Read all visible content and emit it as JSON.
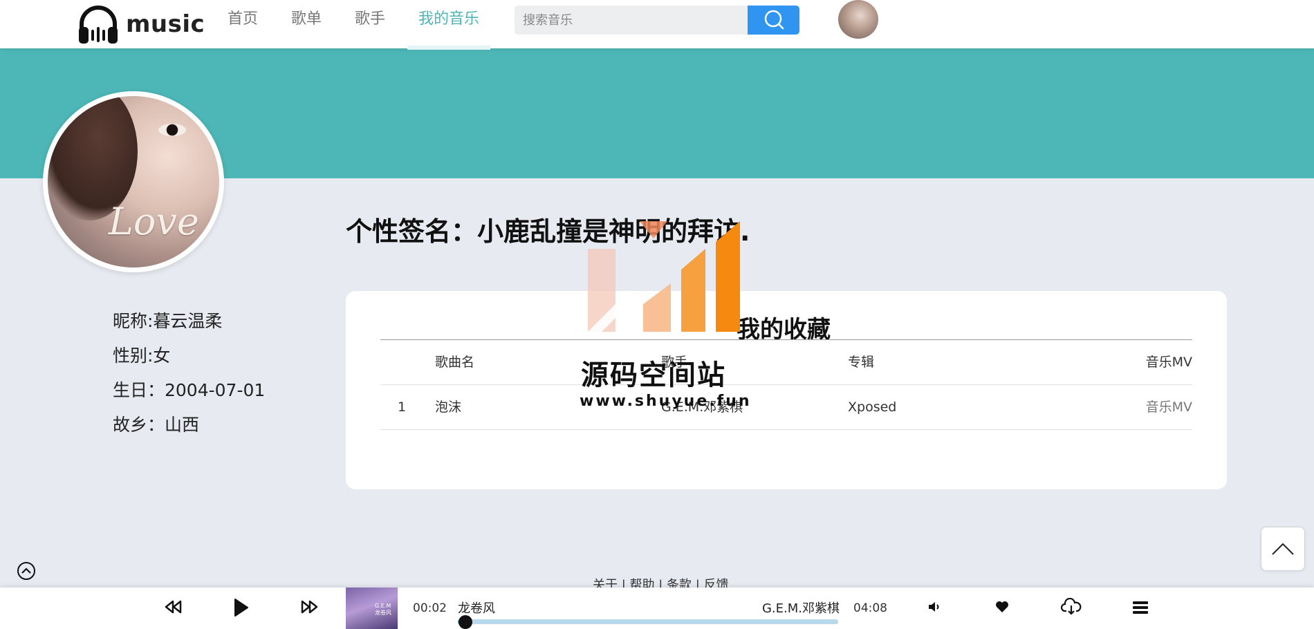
{
  "header": {
    "logo_text": "music",
    "nav": [
      {
        "label": "首页",
        "active": false
      },
      {
        "label": "歌单",
        "active": false
      },
      {
        "label": "歌手",
        "active": false
      },
      {
        "label": "我的音乐",
        "active": true
      }
    ],
    "search_placeholder": "搜索音乐",
    "icons": {
      "logo": "headphones-icon",
      "search": "search-icon"
    }
  },
  "profile": {
    "signature": "个性签名：小鹿乱撞是神明的拜访.",
    "nickname": "昵称:暮云温柔",
    "gender": "性别:女",
    "birthday": "生日：2004-07-01",
    "hometown": "故乡：山西"
  },
  "collection": {
    "title": "我的收藏",
    "columns": [
      "",
      "歌曲名",
      "歌手",
      "专辑",
      "音乐MV"
    ],
    "rows": [
      {
        "index": "1",
        "name": "泡沫",
        "artist": "G.E.M.邓紫棋",
        "album": "Xposed",
        "mv": "音乐MV"
      }
    ]
  },
  "watermark": {
    "line1": "源码空间站",
    "line2": "www.shuyue.fun"
  },
  "footer": {
    "links": "关于 | 帮助 | 条款 | 反馈"
  },
  "player": {
    "current_time": "00:02",
    "total_time": "04:08",
    "song_title": "龙卷风",
    "artist": "G.E.M.邓紫棋",
    "progress": 0.02,
    "cover_text": "G.E.M 龙卷风"
  },
  "colors": {
    "accent": "#4eb5b7",
    "banner": "#4db6b6",
    "search_button": "#2f95f0"
  }
}
